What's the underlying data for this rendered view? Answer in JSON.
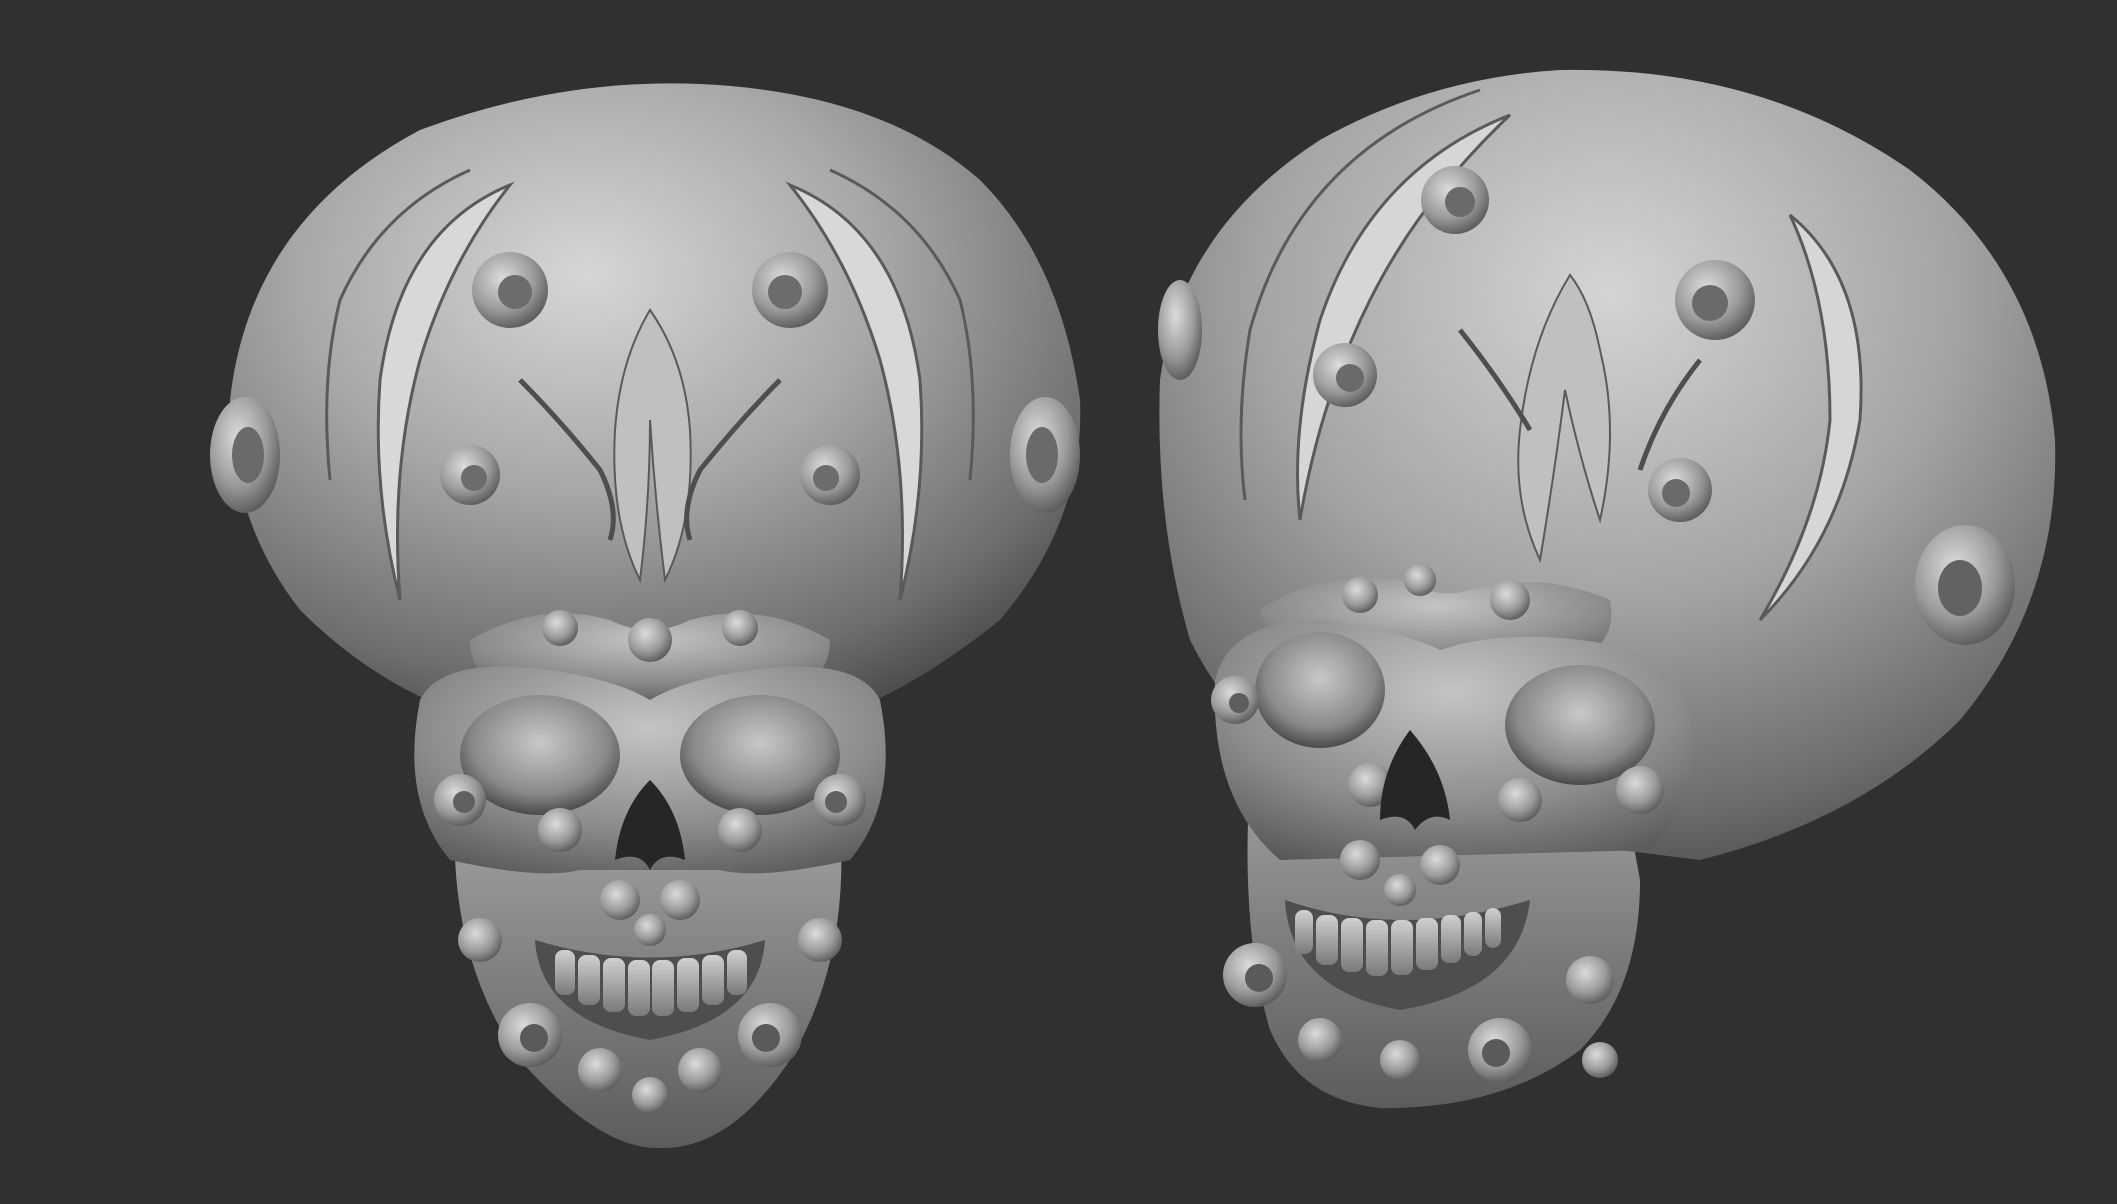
{
  "canvas": {
    "background_color": "#303030",
    "model_base_color": "#9a9a9a",
    "model_highlight_color": "#d2d2d2",
    "model_shadow_color": "#4a4a4a"
  },
  "models": [
    {
      "name": "ornamental-skull",
      "view": "front"
    },
    {
      "name": "ornamental-skull",
      "view": "three-quarter"
    }
  ]
}
